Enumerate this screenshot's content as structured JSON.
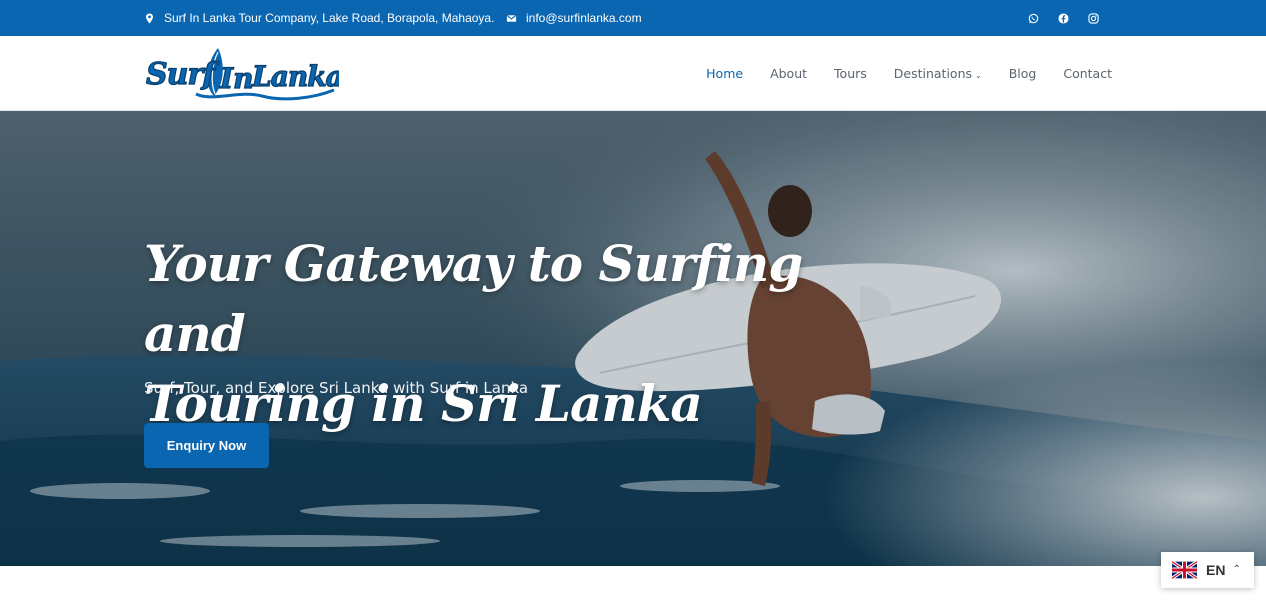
{
  "topbar": {
    "address": "Surf In Lanka Tour Company, Lake Road, Borapola, Mahaoya.",
    "email": "info@surfinlanka.com",
    "social": [
      "whatsapp-icon",
      "facebook-icon",
      "instagram-icon"
    ],
    "bg_color": "#0a66b0"
  },
  "logo": {
    "text": "Surf In Lanka"
  },
  "nav": {
    "items": [
      {
        "label": "Home",
        "active": true
      },
      {
        "label": "About"
      },
      {
        "label": "Tours"
      },
      {
        "label": "Destinations",
        "has_dropdown": true
      },
      {
        "label": "Blog"
      },
      {
        "label": "Contact"
      }
    ],
    "active_color": "#0a66b0"
  },
  "hero": {
    "title_line1": "Your Gateway to Surfing and",
    "title_line2": "Touring in Sri Lanka",
    "subtitle": "Surf, Tour, and Explore Sri Lanka with Surf in Lanka",
    "cta_label": "Enquiry Now"
  },
  "language": {
    "code": "EN",
    "flag": "uk-flag-icon"
  }
}
